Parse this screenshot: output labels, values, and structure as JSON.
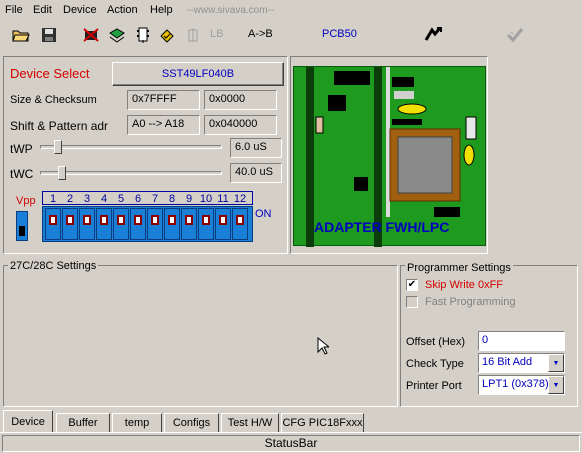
{
  "menu": {
    "file": "File",
    "edit": "Edit",
    "device": "Device",
    "action": "Action",
    "help": "Help",
    "watermark": "--www.sivava.com--"
  },
  "toolbar": {
    "lb": "LB",
    "atob": "A->B",
    "pcb": "PCB50",
    "icons": [
      "open-folder-icon",
      "save-disk-icon",
      "erase-chip-icon",
      "read-chip-icon",
      "program-chip-icon",
      "verify-chip-icon",
      "blank-check-icon",
      "lightning-icon",
      "checkmark-icon"
    ]
  },
  "device": {
    "select_label": "Device Select",
    "device_name": "SST49LF040B",
    "size_label": "Size & Checksum",
    "size_value": "0x7FFFF",
    "checksum_value": "0x0000",
    "shift_label": "Shift & Pattern adr",
    "shift_value": "A0 --> A18",
    "pattern_value": "0x040000",
    "twp_label": "tWP",
    "twp_value": "6.0 uS",
    "twc_label": "tWC",
    "twc_value": "40.0 uS",
    "vpp_label": "Vpp",
    "dip_numbers": [
      "1",
      "2",
      "3",
      "4",
      "5",
      "6",
      "7",
      "8",
      "9",
      "10",
      "11",
      "12"
    ],
    "dip_on_label": "ON"
  },
  "adapter": {
    "label": "ADAPTER FWH/LPC"
  },
  "eprom": {
    "title": "27C/28C Settings"
  },
  "programmer": {
    "title": "Programmer Settings",
    "skip_write_label": "Skip Write 0xFF",
    "skip_write_checked": true,
    "fast_prog_label": "Fast Programming",
    "fast_prog_checked": false,
    "offset_label": "Offset (Hex)",
    "offset_value": "0",
    "check_type_label": "Check Type",
    "check_type_value": "16 Bit Add",
    "printer_port_label": "Printer Port",
    "printer_port_value": "LPT1 (0x378)"
  },
  "tabs": [
    "Device",
    "Buffer",
    "temp",
    "Configs",
    "Test H/W",
    "CFG PIC18Fxxx"
  ],
  "statusbar": "StatusBar",
  "colors": {
    "face": "#d4d0c8",
    "pcb_green": "#1e9a1e",
    "dip_blue": "#1a7fd6",
    "accent_blue": "#0000c0",
    "device_red": "#d40000"
  }
}
